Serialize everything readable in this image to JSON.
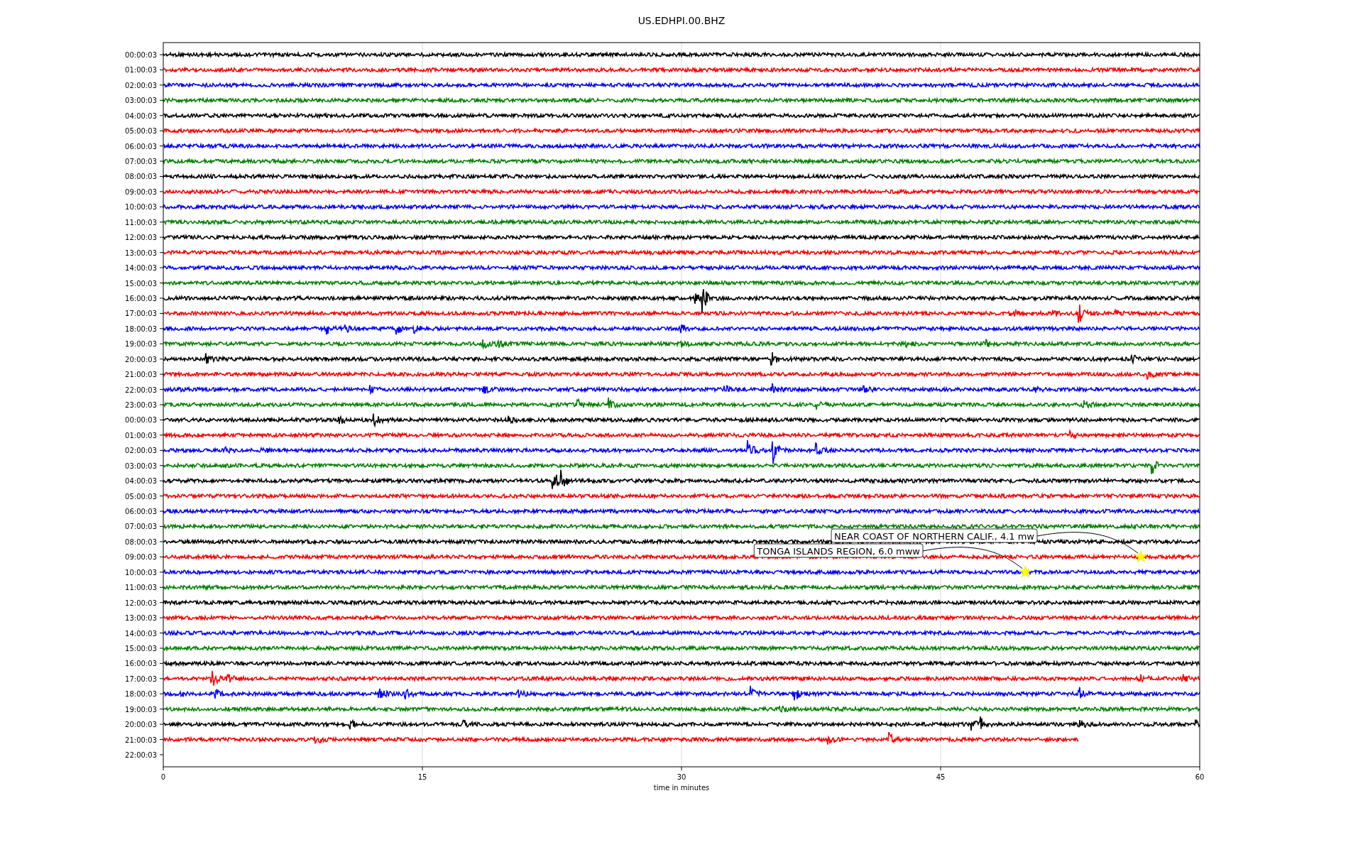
{
  "chart": {
    "title": "US.EDHPI.00.BHZ",
    "xlabel": "time in minutes",
    "xticks": [
      "0",
      "15",
      "30",
      "45",
      "60"
    ],
    "rows": [
      {
        "label": "00:00:03",
        "color": "#000000",
        "level": 1
      },
      {
        "label": "01:00:03",
        "color": "#ff0000",
        "level": 1
      },
      {
        "label": "02:00:03",
        "color": "#0000ff",
        "level": 1
      },
      {
        "label": "03:00:03",
        "color": "#008000",
        "level": 1
      },
      {
        "label": "04:00:03",
        "color": "#000000",
        "level": 1
      },
      {
        "label": "05:00:03",
        "color": "#ff0000",
        "level": 1
      },
      {
        "label": "06:00:03",
        "color": "#0000ff",
        "level": 1
      },
      {
        "label": "07:00:03",
        "color": "#008000",
        "level": 1
      },
      {
        "label": "08:00:03",
        "color": "#000000",
        "level": 1
      },
      {
        "label": "09:00:03",
        "color": "#ff0000",
        "level": 1
      },
      {
        "label": "10:00:03",
        "color": "#0000ff",
        "level": 1
      },
      {
        "label": "11:00:03",
        "color": "#008000",
        "level": 1
      },
      {
        "label": "12:00:03",
        "color": "#000000",
        "level": 1
      },
      {
        "label": "13:00:03",
        "color": "#ff0000",
        "level": 1
      },
      {
        "label": "14:00:03",
        "color": "#0000ff",
        "level": 1
      },
      {
        "label": "15:00:03",
        "color": "#008000",
        "level": 1
      },
      {
        "label": "16:00:03",
        "color": "#000000",
        "level": 1
      },
      {
        "label": "17:00:03",
        "color": "#ff0000",
        "level": 1
      },
      {
        "label": "18:00:03",
        "color": "#0000ff",
        "level": 1
      },
      {
        "label": "19:00:03",
        "color": "#008000",
        "level": 1
      },
      {
        "label": "20:00:03",
        "color": "#000000",
        "level": 1
      },
      {
        "label": "21:00:03",
        "color": "#ff0000",
        "level": 1
      },
      {
        "label": "22:00:03",
        "color": "#0000ff",
        "level": 1
      },
      {
        "label": "23:00:03",
        "color": "#008000",
        "level": 1
      },
      {
        "label": "00:00:03",
        "color": "#000000",
        "level": 1
      },
      {
        "label": "01:00:03",
        "color": "#ff0000",
        "level": 1
      },
      {
        "label": "02:00:03",
        "color": "#0000ff",
        "level": 1
      },
      {
        "label": "03:00:03",
        "color": "#008000",
        "level": 1
      },
      {
        "label": "04:00:03",
        "color": "#000000",
        "level": 1
      },
      {
        "label": "05:00:03",
        "color": "#ff0000",
        "level": 1
      },
      {
        "label": "06:00:03",
        "color": "#0000ff",
        "level": 1
      },
      {
        "label": "07:00:03",
        "color": "#008000",
        "level": 1
      },
      {
        "label": "08:00:03",
        "color": "#000000",
        "level": 1
      },
      {
        "label": "09:00:03",
        "color": "#ff0000",
        "level": 1,
        "event_label": "NEAR COAST OF NORTHERN CALIF., 4.1 mw"
      },
      {
        "label": "10:00:03",
        "color": "#0000ff",
        "level": 1,
        "event_label": "TONGA ISLANDS REGION, 6.0 mww"
      },
      {
        "label": "11:00:03",
        "color": "#008000",
        "level": 1
      },
      {
        "label": "12:00:03",
        "color": "#000000",
        "level": 1
      },
      {
        "label": "13:00:03",
        "color": "#ff0000",
        "level": 1
      },
      {
        "label": "14:00:03",
        "color": "#0000ff",
        "level": 1
      },
      {
        "label": "15:00:03",
        "color": "#008000",
        "level": 1
      },
      {
        "label": "16:00:03",
        "color": "#000000",
        "level": 1
      },
      {
        "label": "17:00:03",
        "color": "#ff0000",
        "level": 1
      },
      {
        "label": "18:00:03",
        "color": "#0000ff",
        "level": 1
      },
      {
        "label": "19:00:03",
        "color": "#008000",
        "level": 1
      },
      {
        "label": "20:00:03",
        "color": "#000000",
        "level": 1
      },
      {
        "label": "21:00:03",
        "color": "#ff0000",
        "level": 0.883
      },
      {
        "label": "22:00:03"
      }
    ]
  }
}
